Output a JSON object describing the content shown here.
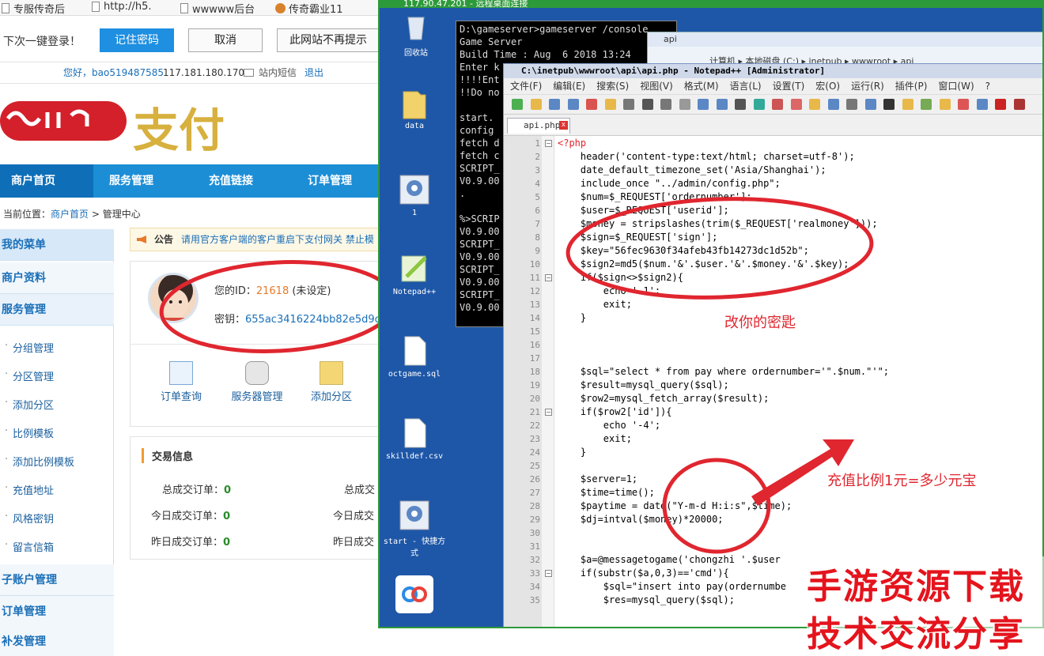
{
  "browser": {
    "bookmarks": [
      "专服传奇后",
      "http://h5.",
      "wwwww后台",
      "传奇霸业11"
    ],
    "password_bar": {
      "prompt": "下次一键登录！",
      "remember": "记住密码",
      "cancel": "取消",
      "never": "此网站不再提示"
    }
  },
  "site": {
    "user_bar": {
      "greeting": "您好，bao519487585",
      "ip": "117.181.180.170",
      "messages": "站内短信",
      "logout": "退出"
    },
    "logo_text": "支付",
    "nav": [
      "商户首页",
      "服务管理",
      "充值链接",
      "订单管理"
    ],
    "crumb": {
      "label": "当前位置：",
      "home": "商户首页",
      "sep": " > ",
      "current": "管理中心"
    },
    "menu": {
      "my_menu": "我的菜单",
      "profile": "商户资料",
      "service": "服务管理",
      "items": [
        "分组管理",
        "分区管理",
        "添加分区",
        "比例模板",
        "添加比例模板",
        "充值地址",
        "风格密钥",
        "留言信箱"
      ],
      "sub_account": "子账户管理",
      "orders": "订单管理",
      "resend": "补发管理"
    },
    "notice": {
      "label": "公告",
      "text": "请用官方客户端的客户重启下支付网关  禁止模"
    },
    "profile": {
      "id_label": "您的ID：",
      "id_value": "21618",
      "id_status": "(未设定)",
      "key_label": "密钥：",
      "key_value": "655ac3416224bb82e5d9c"
    },
    "quick": [
      "订单查询",
      "服务器管理",
      "添加分区"
    ],
    "trade": {
      "title": "交易信息",
      "rows": [
        {
          "label": "总成交订单：",
          "value": "0"
        },
        {
          "label": "今日成交订单：",
          "value": "0"
        },
        {
          "label": "昨日成交订单：",
          "value": "0"
        }
      ],
      "right_labels": [
        "总成交",
        "今日成交",
        "昨日成交"
      ]
    }
  },
  "remote": {
    "title": "117.90.47.201 - 远程桌面连接",
    "desktop_icons": [
      "回收站",
      "data",
      "1",
      "Notepad++",
      "octgame.sql",
      "skilldef.csv",
      "start - 快捷方式"
    ],
    "console_lines": [
      "D:\\gameserver>gameserver /console",
      "Game Server",
      "Build Time : Aug  6 2018 13:24",
      "Enter k",
      "!!!!Ent",
      "!!Do no",
      "",
      "start.",
      "config",
      "fetch d",
      "fetch c",
      "SCRIPT_",
      "V0.9.00",
      ".",
      "",
      "%>SCRIP",
      "V0.9.00",
      "SCRIPT_",
      "V0.9.00",
      "SCRIPT_",
      "V0.9.00",
      "SCRIPT_",
      "V0.9.00"
    ],
    "explorer_title": "api",
    "explorer_path": "计算机  ▸  本地磁盘 (C:)  ▸  inetpub  ▸  wwwroot  ▸  api"
  },
  "notepad": {
    "title": "C:\\inetpub\\wwwroot\\api\\api.php - Notepad++ [Administrator]",
    "menu": [
      "文件(F)",
      "编辑(E)",
      "搜索(S)",
      "视图(V)",
      "格式(M)",
      "语言(L)",
      "设置(T)",
      "宏(O)",
      "运行(R)",
      "插件(P)",
      "窗口(W)",
      "?"
    ],
    "tab": "api.php",
    "code": [
      "<?php",
      "    header('content-type:text/html; charset=utf-8');",
      "    date_default_timezone_set('Asia/Shanghai');",
      "    include_once \"../admin/config.php\";",
      "    $num=$_REQUEST['ordernumber'];",
      "    $user=$_REQUEST['userid'];",
      "    $money = stripslashes(trim($_REQUEST['realmoney']));",
      "    $sign=$_REQUEST['sign'];",
      "    $key=\"56fec9630f34afeb43fb14273dc1d52b\";",
      "    $sign2=md5($num.'&'.$user.'&'.$money.'&'.$key);",
      "    if($sign<>$sign2){",
      "        echo '-1';",
      "        exit;",
      "    }",
      "",
      "",
      "",
      "    $sql=\"select * from pay where ordernumber='\".$num.\"'\";",
      "    $result=mysql_query($sql);",
      "    $row2=mysql_fetch_array($result);",
      "    if($row2['id']){",
      "        echo '-4';",
      "        exit;",
      "    }",
      "",
      "    $server=1;",
      "    $time=time();",
      "    $paytime = date(\"Y-m-d H:i:s\",$time);",
      "    $dj=intval($money)*20000;",
      "",
      "",
      "    $a=@messagetogame('chongzhi '.$user",
      "    if(substr($a,0,3)=='cmd'){",
      "        $sql=\"insert into pay(ordernumbe",
      "        $res=mysql_query($sql);"
    ]
  },
  "annotations": {
    "key_note": "改你的密匙",
    "ratio_note": "充值比例1元=多少元宝"
  },
  "watermark": [
    "手游资源下载",
    "技术交流分享"
  ],
  "colors": {
    "nav_blue": "#1c8ed6",
    "annotation_red": "#e0262f",
    "rdp_green": "#2d9a3a"
  }
}
